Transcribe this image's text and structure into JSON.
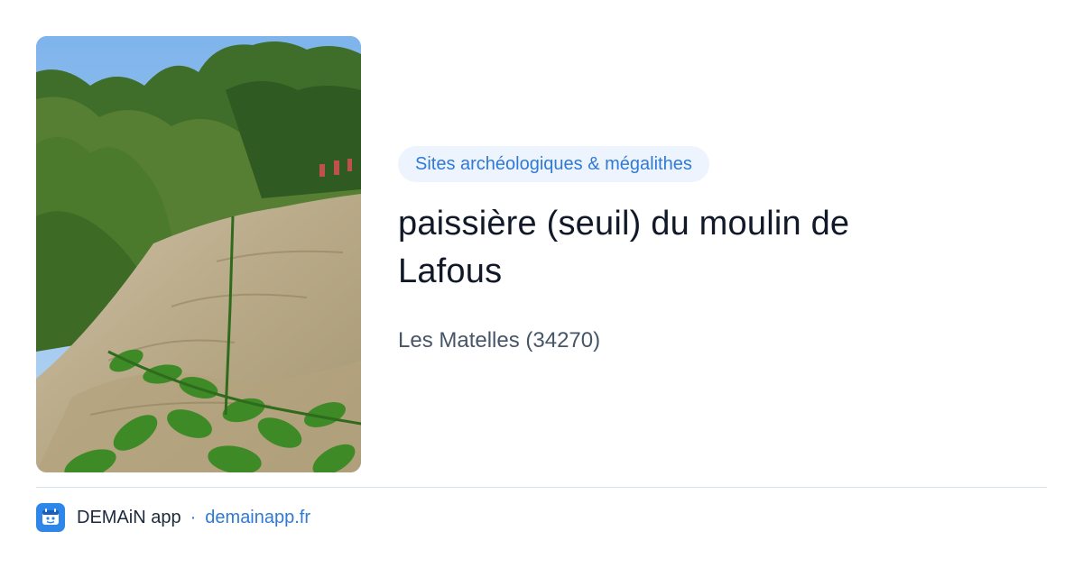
{
  "card": {
    "image_alt": "photo-site",
    "category": "Sites archéologiques & mégalithes",
    "title_line1": "paissière (seuil) du moulin de",
    "title_line2": "Lafous",
    "location": "Les Matelles (34270)"
  },
  "footer": {
    "app_icon": "app-logo-icon",
    "app_name": "DEMAiN app",
    "separator": "·",
    "domain": "demainapp.fr"
  },
  "colors": {
    "accent": "#2f7ad6",
    "chip_bg": "#eef4fd",
    "title": "#111827",
    "muted": "#475569",
    "divider": "#d7e3ea"
  }
}
